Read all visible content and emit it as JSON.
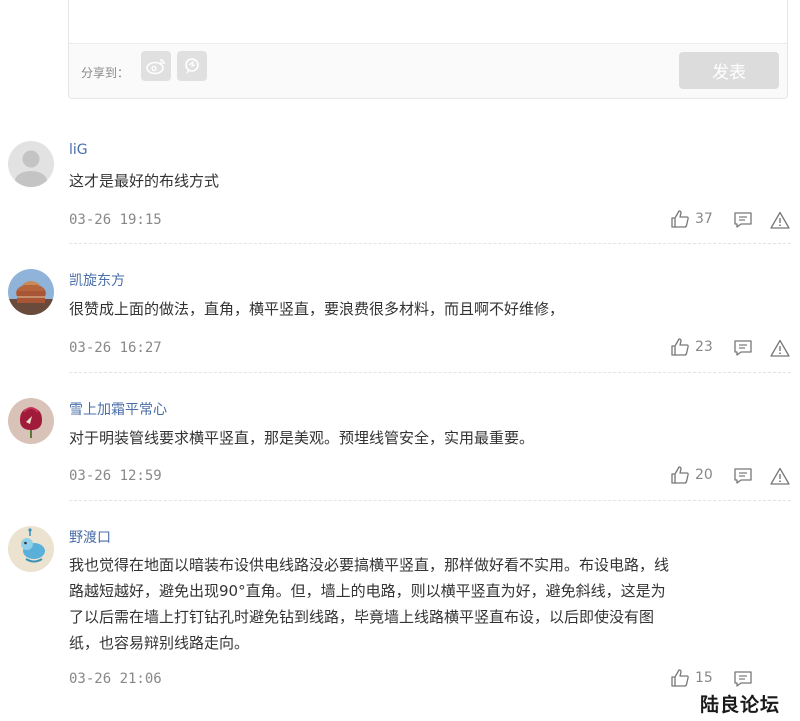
{
  "editor": {
    "share_label": "分享到：",
    "submit_label": "发表"
  },
  "comments": [
    {
      "username": "liG",
      "content": "这才是最好的布线方式",
      "time": "03-26 19:15",
      "likes": "37"
    },
    {
      "username": "凯旋东方",
      "content": "很赞成上面的做法，直角，横平竖直，要浪费很多材料，而且啊不好维修，",
      "time": "03-26 16:27",
      "likes": "23"
    },
    {
      "username": "雪上加霜平常心",
      "content": "对于明装管线要求横平竖直，那是美观。预埋线管安全，实用最重要。",
      "time": "03-26 12:59",
      "likes": "20"
    },
    {
      "username": "野渡口",
      "content": "我也觉得在地面以暗装布设供电线路没必要搞横平竖直，那样做好看不实用。布设电路，线\n路越短越好，避免出现90°直角。但，墙上的电路，则以横平竖直为好，避免斜线，这是为\n了以后需在墙上打钉钻孔时避免钻到线路，毕竟墙上线路横平竖直布设，以后即使没有图\n纸，也容易辩别线路走向。",
      "time": "03-26 21:06",
      "likes": "15"
    }
  ],
  "icons": {
    "weibo": "weibo-icon",
    "qzone": "qzone-icon",
    "like": "thumbs-up-icon",
    "reply": "comment-icon",
    "report": "warning-icon"
  },
  "watermark": "陆良论坛"
}
